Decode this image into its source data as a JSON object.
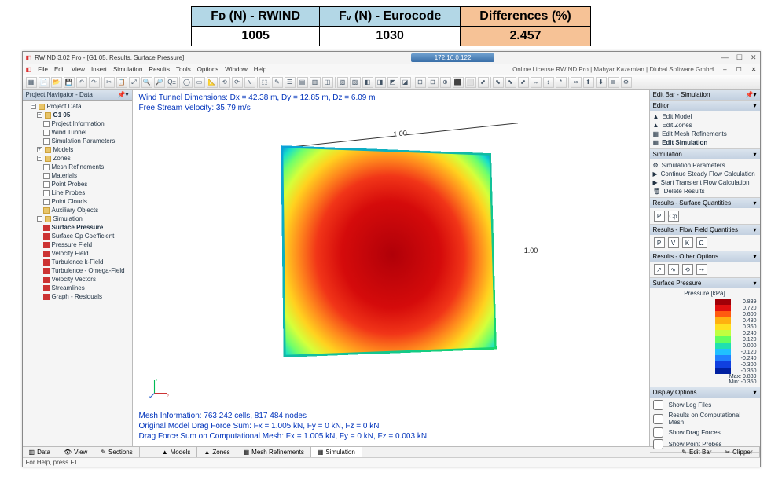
{
  "compare": {
    "h1": "Fᴅ (N) - RWIND",
    "h2": "Fᵥ (N) - Eurocode",
    "h3": "Differences (%)",
    "v1": "1005",
    "v2": "1030",
    "v3": "2.457"
  },
  "titlebar": {
    "appicon": "◧",
    "title": "RWIND 3.02 Pro - [G1 05, Results, Surface Pressure]",
    "ip": "172.16.0.122",
    "min": "—",
    "max": "☐",
    "close": "✕"
  },
  "menu": {
    "items": [
      "File",
      "Edit",
      "View",
      "Insert",
      "Simulation",
      "Results",
      "Tools",
      "Options",
      "Window",
      "Help"
    ],
    "license": "Online License RWIND Pro | Mahyar Kazemian | Dlubal Software GmbH",
    "mdi_min": "–",
    "mdi_max": "☐",
    "mdi_close": "✕"
  },
  "toolbar_icons": [
    "▦",
    "📄",
    "📂",
    "💾",
    "↶",
    "↷",
    "✂",
    "📋",
    "⤢",
    "🔍",
    "🔎",
    "Q±",
    "◯",
    "▭",
    "📐",
    "⟲",
    "⟳",
    "∿",
    "⬚",
    "✎",
    "☰",
    "▤",
    "▥",
    "◫",
    "▧",
    "▨",
    "◧",
    "◨",
    "◩",
    "◪",
    "⊞",
    "⊟",
    "⊕",
    "⬛",
    "⬜",
    "⬈",
    "⬉",
    "⬊",
    "⬋",
    "↔",
    "↕",
    "*",
    "∞",
    "⬆",
    "⬇",
    "≣",
    "⚙"
  ],
  "navigator": {
    "head": "Project Navigator - Data",
    "pin": "📌▾",
    "root": "Project Data",
    "project": "G1 05",
    "items": [
      {
        "icon": "ico-page",
        "label": "Project Information"
      },
      {
        "icon": "ico-page",
        "label": "Wind Tunnel"
      },
      {
        "icon": "ico-page",
        "label": "Simulation Parameters"
      }
    ],
    "models": "Models",
    "zones": "Zones",
    "zones_items": [
      {
        "icon": "ico-page",
        "label": "Mesh Refinements"
      },
      {
        "icon": "ico-page",
        "label": "Materials"
      },
      {
        "icon": "ico-page",
        "label": "Point Probes"
      },
      {
        "icon": "ico-page",
        "label": "Line Probes"
      },
      {
        "icon": "ico-page",
        "label": "Point Clouds"
      },
      {
        "icon": "ico-folder",
        "label": "Auxiliary Objects"
      }
    ],
    "simulation": "Simulation",
    "sim_items": [
      {
        "icon": "ico-red",
        "label": "Surface Pressure",
        "bold": true
      },
      {
        "icon": "ico-red",
        "label": "Surface Cp Coefficient"
      },
      {
        "icon": "ico-red",
        "label": "Pressure Field"
      },
      {
        "icon": "ico-red",
        "label": "Velocity Field"
      },
      {
        "icon": "ico-red",
        "label": "Turbulence k-Field"
      },
      {
        "icon": "ico-red",
        "label": "Turbulence - Omega-Field"
      },
      {
        "icon": "ico-red",
        "label": "Velocity Vectors"
      },
      {
        "icon": "ico-red",
        "label": "Streamlines"
      },
      {
        "icon": "ico-red",
        "label": "Graph - Residuals"
      }
    ]
  },
  "viewport": {
    "info1": "Wind Tunnel Dimensions: Dx = 42.38 m, Dy = 12.85 m, Dz = 6.09 m",
    "info2": "Free Stream Velocity: 35.79 m/s",
    "mesh": "Mesh Information: 763 242 cells, 817 484 nodes",
    "drag1": "Original Model Drag Force Sum: Fx = 1.005 kN, Fy = 0 kN, Fz = 0 kN",
    "drag2": "Drag Force Sum on Computational Mesh: Fx = 1.005 kN, Fy = 0 kN, Fz = 0.003 kN",
    "dim_top": "1.00",
    "dim_right": "1.00"
  },
  "editbar": {
    "head": "Edit Bar - Simulation",
    "pin": "📌▾",
    "editor": "Editor",
    "editor_items": [
      {
        "icon": "▲",
        "label": "Edit Model"
      },
      {
        "icon": "▲",
        "label": "Edit Zones"
      },
      {
        "icon": "▦",
        "label": "Edit Mesh Refinements"
      },
      {
        "icon": "▦",
        "label": "Edit Simulation",
        "bold": true
      }
    ],
    "sim_head": "Simulation",
    "sim_items": [
      {
        "icon": "⚙",
        "label": "Simulation Parameters ..."
      },
      {
        "icon": "▶",
        "label": "Continue Steady Flow Calculation"
      },
      {
        "icon": "▶",
        "label": "Start Transient Flow Calculation"
      },
      {
        "icon": "🗑",
        "label": "Delete Results"
      }
    ],
    "rsq_head": "Results - Surface Quantities",
    "rsq_btns": [
      "P",
      "Cp"
    ],
    "rfq_head": "Results - Flow Field Quantities",
    "rfq_btns": [
      "P",
      "V",
      "K",
      "Ω"
    ],
    "roo_head": "Results - Other Options",
    "roo_btns": [
      "↗",
      "∿",
      "⟲",
      "⇢"
    ],
    "sp_head": "Surface Pressure",
    "sp_unit": "Pressure [kPa]",
    "legend": [
      {
        "c": "#a00008",
        "v": "0.839"
      },
      {
        "c": "#e01010",
        "v": "0.720"
      },
      {
        "c": "#ff5a10",
        "v": "0.600"
      },
      {
        "c": "#ffb010",
        "v": "0.480"
      },
      {
        "c": "#ffe020",
        "v": "0.360"
      },
      {
        "c": "#c0ff40",
        "v": "0.240"
      },
      {
        "c": "#60ff60",
        "v": "0.120"
      },
      {
        "c": "#20e0b0",
        "v": "0.000"
      },
      {
        "c": "#20c0ff",
        "v": "-0.120"
      },
      {
        "c": "#2080ff",
        "v": "-0.240"
      },
      {
        "c": "#1040e0",
        "v": "-0.300"
      },
      {
        "c": "#0020a0",
        "v": "-0.350"
      }
    ],
    "legend_max": "Max:   0.839",
    "legend_min": "Min:  -0.350",
    "disp_head": "Display Options",
    "disp_items": [
      {
        "checked": false,
        "label": "Show Log Files"
      },
      {
        "checked": false,
        "label": "Results on Computational Mesh"
      },
      {
        "checked": false,
        "label": "Show Drag Forces"
      },
      {
        "checked": false,
        "label": "Show Point Probes"
      }
    ]
  },
  "bottomtabs": {
    "left": [
      {
        "icon": "▥",
        "label": "Data"
      },
      {
        "icon": "👁",
        "label": "View"
      },
      {
        "icon": "✎",
        "label": "Sections"
      }
    ],
    "center": [
      {
        "icon": "▲",
        "label": "Models"
      },
      {
        "icon": "▲",
        "label": "Zones"
      },
      {
        "icon": "▦",
        "label": "Mesh Refinements"
      },
      {
        "icon": "▦",
        "label": "Simulation",
        "active": true
      }
    ],
    "right": [
      {
        "icon": "✎",
        "label": "Edit Bar"
      },
      {
        "icon": "✂",
        "label": "Clipper"
      }
    ]
  },
  "statusbar": {
    "text": "For Help, press F1"
  }
}
